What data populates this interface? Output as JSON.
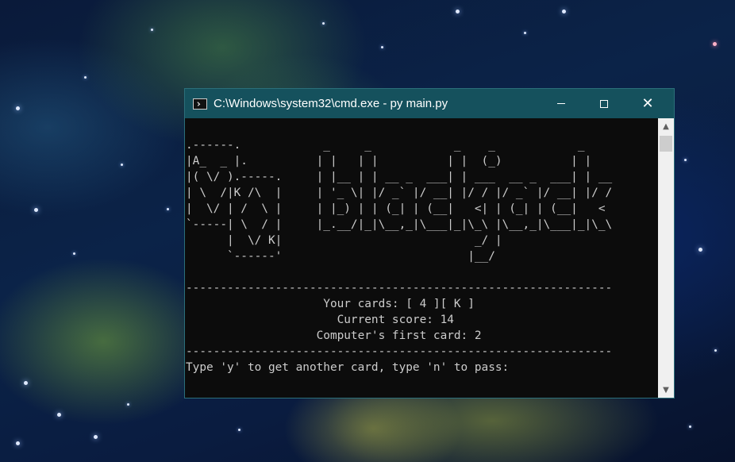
{
  "window": {
    "title": "C:\\Windows\\system32\\cmd.exe - py  main.py",
    "icon": "console-app-icon",
    "controls": {
      "minimize": "minimize-icon",
      "maximize": "maximize-icon",
      "close": "close-icon"
    },
    "close_glyph": "✕"
  },
  "console": {
    "lines": [
      ".------.            _     _            _    _            _",
      "|A_  _ |.          | |   | |          | |  (_)          | |",
      "|( \\/ ).-----.     | |__ | | __ _  ___| | ___  __ _  ___| | __",
      "| \\  /|K /\\  |     | '_ \\| |/ _` |/ __| |/ / |/ _` |/ __| |/ /",
      "|  \\/ | /  \\ |     | |_) | | (_| | (__|   <| | (_| | (__|   <",
      "`-----| \\  / |     |_.__/|_|\\__,_|\\___|_|\\_\\ |\\__,_|\\___|_|\\_\\",
      "      |  \\/ K|                            _/ |",
      "      `------'                           |__/",
      "",
      "--------------------------------------------------------------",
      "                    Your cards: [ 4 ][ K ]",
      "                      Current score: 14",
      "                   Computer's first card: 2",
      "--------------------------------------------------------------",
      "Type 'y' to get another card, type 'n' to pass:"
    ]
  },
  "scrollbar": {
    "up_glyph": "▲",
    "down_glyph": "▼"
  }
}
